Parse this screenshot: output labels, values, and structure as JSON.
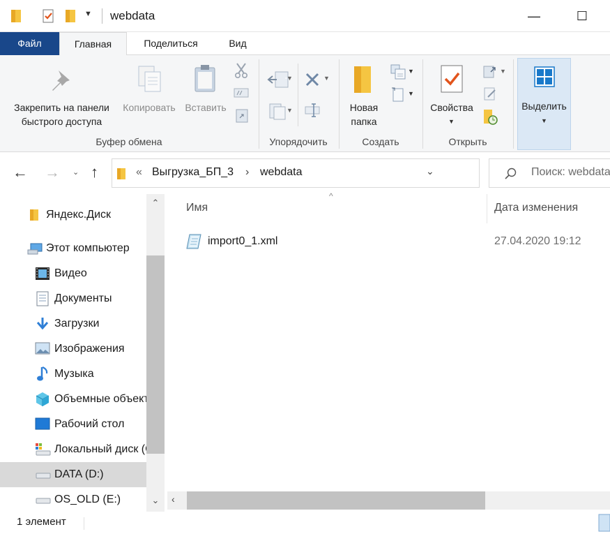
{
  "window": {
    "title": "webdata",
    "minimize_glyph": "—",
    "maximize_glyph": "☐"
  },
  "tabs": {
    "file": "Файл",
    "home": "Главная",
    "share": "Поделиться",
    "view": "Вид"
  },
  "ribbon": {
    "clipboard": {
      "pin_line1": "Закрепить на панели",
      "pin_line2": "быстрого доступа",
      "copy": "Копировать",
      "paste": "Вставить",
      "group": "Буфер обмена"
    },
    "organize": {
      "group": "Упорядочить"
    },
    "new": {
      "new_folder_line1": "Новая",
      "new_folder_line2": "папка",
      "group": "Создать"
    },
    "open": {
      "properties": "Свойства",
      "group": "Открыть"
    },
    "select": {
      "label": "Выделить"
    }
  },
  "address": {
    "overflow": "«",
    "crumbs": [
      "Выгрузка_БП_3",
      "webdata"
    ],
    "search_placeholder": "Поиск: webdata"
  },
  "nav_pane": {
    "items": [
      {
        "label": "Яндекс.Диск",
        "icon": "folder-icon"
      },
      {
        "label": "Этот компьютер",
        "icon": "computer-icon"
      },
      {
        "label": "Видео",
        "icon": "video-icon"
      },
      {
        "label": "Документы",
        "icon": "documents-icon"
      },
      {
        "label": "Загрузки",
        "icon": "download-icon"
      },
      {
        "label": "Изображения",
        "icon": "pictures-icon"
      },
      {
        "label": "Музыка",
        "icon": "music-icon"
      },
      {
        "label": "Объемные объекты",
        "icon": "3d-objects-icon"
      },
      {
        "label": "Рабочий стол",
        "icon": "desktop-icon"
      },
      {
        "label": "Локальный диск (C:)",
        "icon": "drive-icon"
      },
      {
        "label": "DATA (D:)",
        "icon": "drive-icon"
      },
      {
        "label": "OS_OLD (E:)",
        "icon": "drive-icon"
      }
    ]
  },
  "file_list": {
    "columns": {
      "name": "Имя",
      "date": "Дата изменения"
    },
    "files": [
      {
        "name": "import0_1.xml",
        "date": "27.04.2020 19:12",
        "icon": "xml-file-icon"
      }
    ]
  },
  "status": {
    "count": "1 элемент"
  },
  "colors": {
    "accent": "#1979ca",
    "file_tab": "#19478a",
    "folder": "#f5c542",
    "selected_bg": "#d9d9d9"
  }
}
